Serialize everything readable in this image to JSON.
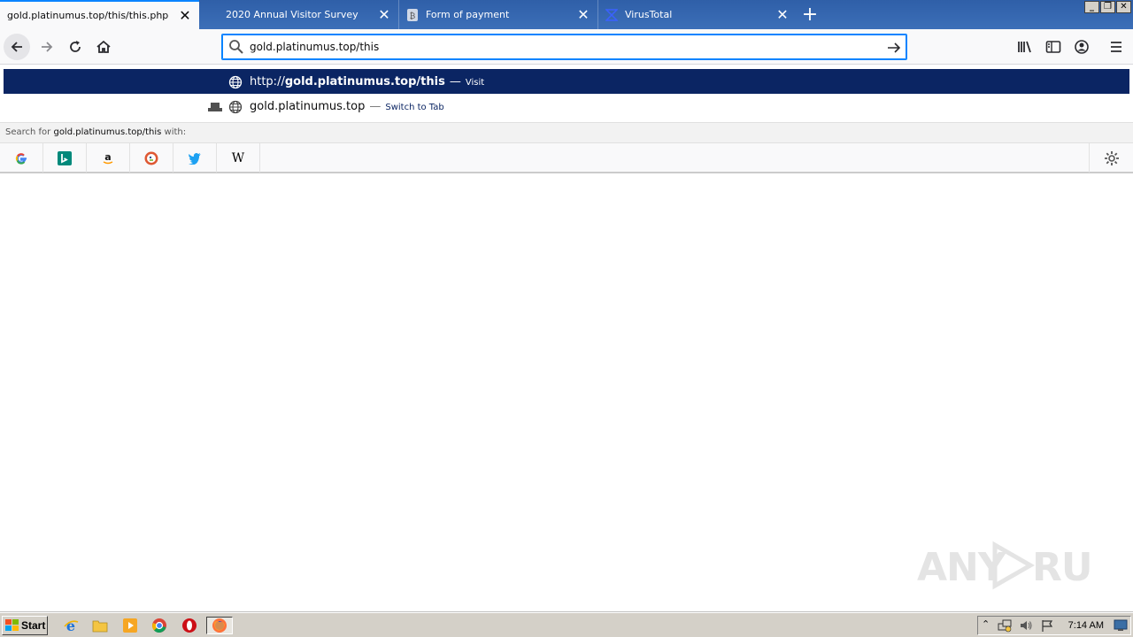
{
  "tabs": [
    {
      "title": "gold.platinumus.top/this/this.php",
      "active": true,
      "favicon": "none"
    },
    {
      "title": "2020 Annual Visitor Survey",
      "active": false,
      "favicon": "none"
    },
    {
      "title": "Form of payment",
      "active": false,
      "favicon": "page-icon"
    },
    {
      "title": "VirusTotal",
      "active": false,
      "favicon": "virustotal-icon"
    }
  ],
  "toolbar": {
    "url_value": "gold.platinumus.top/this",
    "icons": [
      "back-icon",
      "forward-icon",
      "reload-icon",
      "home-icon",
      "library-icon",
      "sidebar-icon",
      "account-icon",
      "menu-icon"
    ]
  },
  "dropdown": {
    "rows": [
      {
        "prefix": "http://",
        "bold": "gold.platinumus.top/this",
        "sep": "—",
        "action": "Visit"
      },
      {
        "prefix": "",
        "bold": "gold.platinumus.top",
        "sep": "—",
        "action": "Switch to Tab"
      }
    ],
    "search_for_prefix": "Search for ",
    "search_for_query": "gold.platinumus.top/this",
    "search_for_suffix": " with:",
    "engines": [
      "google-icon",
      "bing-icon",
      "amazon-icon",
      "duckduckgo-icon",
      "twitter-icon",
      "wikipedia-icon"
    ]
  },
  "watermark": {
    "text": "ANY RUN"
  },
  "taskbar": {
    "start_label": "Start",
    "clock": "7:14 AM",
    "icons": [
      "ie-icon",
      "explorer-icon",
      "media-player-icon",
      "chrome-icon",
      "opera-icon",
      "firefox-icon"
    ]
  }
}
